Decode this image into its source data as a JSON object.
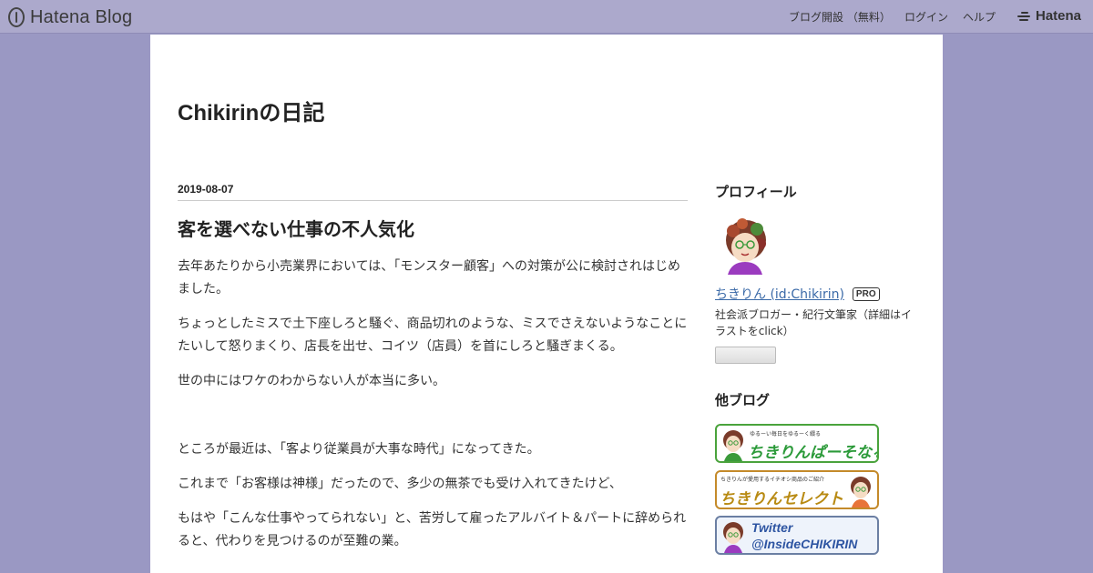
{
  "header": {
    "logo_text": "Hatena Blog",
    "nav": {
      "open_blog": "ブログ開設 （無料）",
      "login": "ログイン",
      "help": "ヘルプ"
    },
    "brand_text": "Hatena"
  },
  "blog": {
    "title": "Chikirinの日記"
  },
  "entry": {
    "date": "2019-08-07",
    "title": "客を選べない仕事の不人気化",
    "paragraphs": [
      "去年あたりから小売業界においては、「モンスター顧客」への対策が公に検討されはじめました。",
      "ちょっとしたミスで土下座しろと騒ぐ、商品切れのような、ミスでさえないようなことにたいして怒りまくり、店長を出せ、コイツ（店員）を首にしろと騒ぎまくる。",
      "世の中にはワケのわからない人が本当に多い。",
      "ところが最近は、「客より従業員が大事な時代」になってきた。",
      "これまで「お客様は神様」だったので、多少の無茶でも受け入れてきたけど、",
      "もはや「こんな仕事やってられない」と、苦労して雇ったアルバイト＆パートに辞められると、代わりを見つけるのが至難の業。"
    ]
  },
  "sidebar": {
    "profile_heading": "プロフィール",
    "profile_name": "ちきりん (id:Chikirin)",
    "pro_badge": "PRO",
    "profile_description": "社会派ブロガー・紀行文筆家（詳細はイラストをclick）",
    "other_blogs_heading": "他ブログ",
    "banners": [
      {
        "small": "ゆるーい毎日をゆるーく綴る",
        "text": "ちきりんぱーそなる"
      },
      {
        "small": "ちきりんが愛用するイチオシ商品のご紹介",
        "text": "ちきりんセレクト"
      },
      {
        "line1": "Twitter",
        "line2": "@InsideCHIKIRIN"
      }
    ]
  },
  "colors": {
    "page_background": "#9a98c3",
    "header_background": "#aca9cc",
    "link": "#3b6aa8",
    "banner_green": "#2b9a39",
    "banner_gold": "#b88a12",
    "banner_blue": "#2e55a2"
  }
}
